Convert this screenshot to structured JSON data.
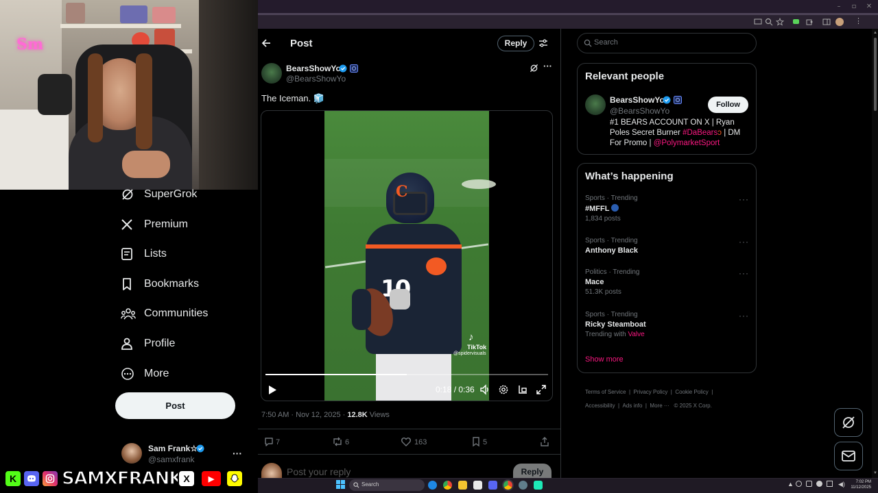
{
  "streamer": {
    "name": "SAMXFRANK",
    "badges": [
      "K",
      "discord",
      "instagram",
      "X",
      "youtube",
      "snapchat"
    ]
  },
  "colors": {
    "accent": "#1d9bf0",
    "pink": "#f91880",
    "bg": "#000000",
    "text": "#e7e9ea",
    "muted": "#71767b",
    "field": "#3f7b33"
  },
  "nav": {
    "items": [
      {
        "label": "SuperGrok",
        "icon": "grok-icon"
      },
      {
        "label": "Premium",
        "icon": "x-logo-icon"
      },
      {
        "label": "Lists",
        "icon": "lists-icon"
      },
      {
        "label": "Bookmarks",
        "icon": "bookmark-icon"
      },
      {
        "label": "Communities",
        "icon": "communities-icon"
      },
      {
        "label": "Profile",
        "icon": "profile-icon"
      },
      {
        "label": "More",
        "icon": "more-circle-icon"
      }
    ],
    "post_button": "Post"
  },
  "me": {
    "name": "Sam Frank☆",
    "handle": "@samxfrank",
    "more": "···"
  },
  "post": {
    "header_title": "Post",
    "reply_button": "Reply",
    "author_name": "BearsShowYo",
    "author_handle": "@BearsShowYo",
    "text": "The Iceman. 🧊",
    "video": {
      "time": "0:18 / 0:36",
      "watermark": "TikTok",
      "watermark_handle": "@spidervisuals",
      "progress": 0.5
    },
    "meta_time": "7:50 AM · Nov 12, 2025 · ",
    "views_count": "12.8K",
    "views_label": " Views",
    "stats": {
      "replies": "7",
      "reposts": "6",
      "likes": "163",
      "bookmarks": "5"
    },
    "reply_placeholder": "Post your reply",
    "reply_button_bottom": "Reply"
  },
  "search": {
    "placeholder": "Search"
  },
  "relevant": {
    "title": "Relevant people",
    "name": "BearsShowYo",
    "handle": "@BearsShowYo",
    "follow": "Follow",
    "bio_a": "#1 BEARS ACCOUNT ON X | Ryan Poles Secret Burner ",
    "bio_tag": "#DaBears",
    "bio_b": " | DM For Promo | ",
    "bio_mention": "@PolymarketSport"
  },
  "happening": {
    "title": "What’s happening",
    "trends": [
      {
        "meta": "Sports · Trending",
        "name": "#MFFL",
        "count": "1,834 posts"
      },
      {
        "meta": "Sports · Trending",
        "name": "Anthony Black",
        "count": ""
      },
      {
        "meta": "Politics · Trending",
        "name": "Mace",
        "count": "51.3K posts"
      },
      {
        "meta": "Sports · Trending",
        "name": "Ricky Steamboat",
        "count": "Trending with ",
        "with": "Valve"
      }
    ],
    "show_more": "Show more"
  },
  "footer": {
    "links": [
      "Terms of Service",
      "Privacy Policy",
      "Cookie Policy",
      "Accessibility",
      "Ads info",
      "More ···",
      "© 2025 X Corp."
    ]
  },
  "taskbar": {
    "search": "Search",
    "time": "7:02 PM",
    "date": "11/12/2025"
  }
}
